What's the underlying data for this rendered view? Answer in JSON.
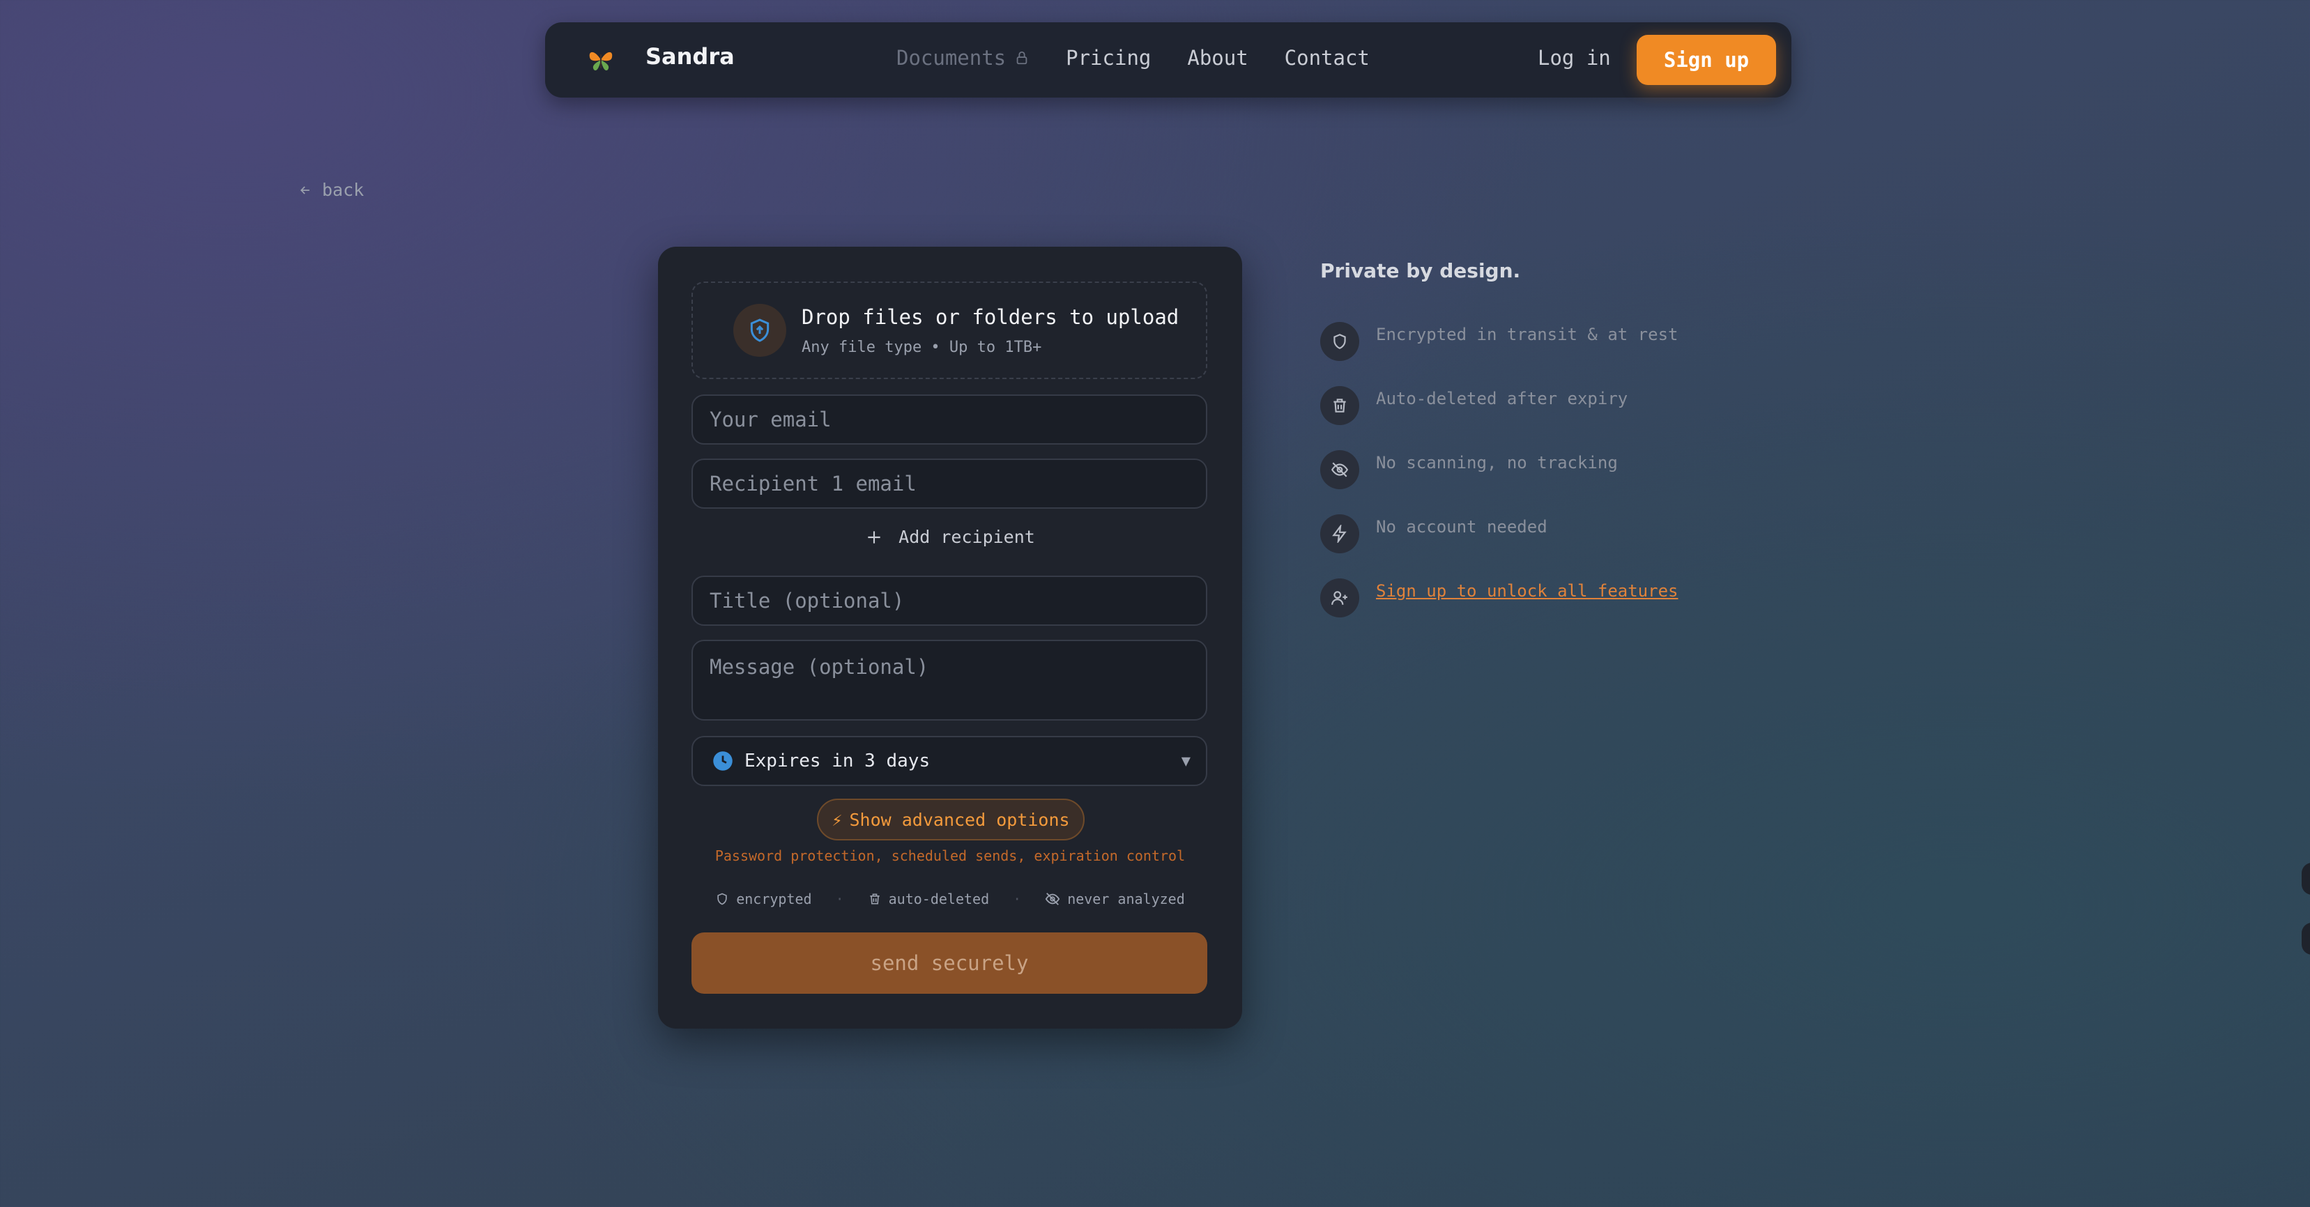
{
  "nav": {
    "brand": "Sandra",
    "links": {
      "documents": "Documents",
      "pricing": "Pricing",
      "about": "About",
      "contact": "Contact"
    },
    "login": "Log in",
    "signup": "Sign up"
  },
  "back": {
    "label": "back"
  },
  "upload": {
    "dropzone_title": "Drop files or folders to upload",
    "dropzone_sub": "Any file type • Up to 1TB+",
    "your_email_placeholder": "Your email",
    "recipient_placeholder": "Recipient 1 email",
    "add_recipient": "Add recipient",
    "title_placeholder": "Title (optional)",
    "message_placeholder": "Message (optional)",
    "expires": "Expires in 3 days",
    "advanced_button": "Show advanced options",
    "advanced_desc": "Password protection, scheduled sends, expiration control",
    "badges": {
      "encrypted": "encrypted",
      "auto_deleted": "auto-deleted",
      "never_analyzed": "never analyzed"
    },
    "send": "send securely"
  },
  "side": {
    "title": "Private by design.",
    "features": {
      "f1": "Encrypted in transit & at rest",
      "f2": "Auto-deleted after expiry",
      "f3": "No scanning, no tracking",
      "f4": "No account needed",
      "f5": "Sign up to unlock all features"
    }
  },
  "colors": {
    "accent": "#f08a24",
    "card": "#1f232c",
    "navbar": "#1f2430"
  }
}
